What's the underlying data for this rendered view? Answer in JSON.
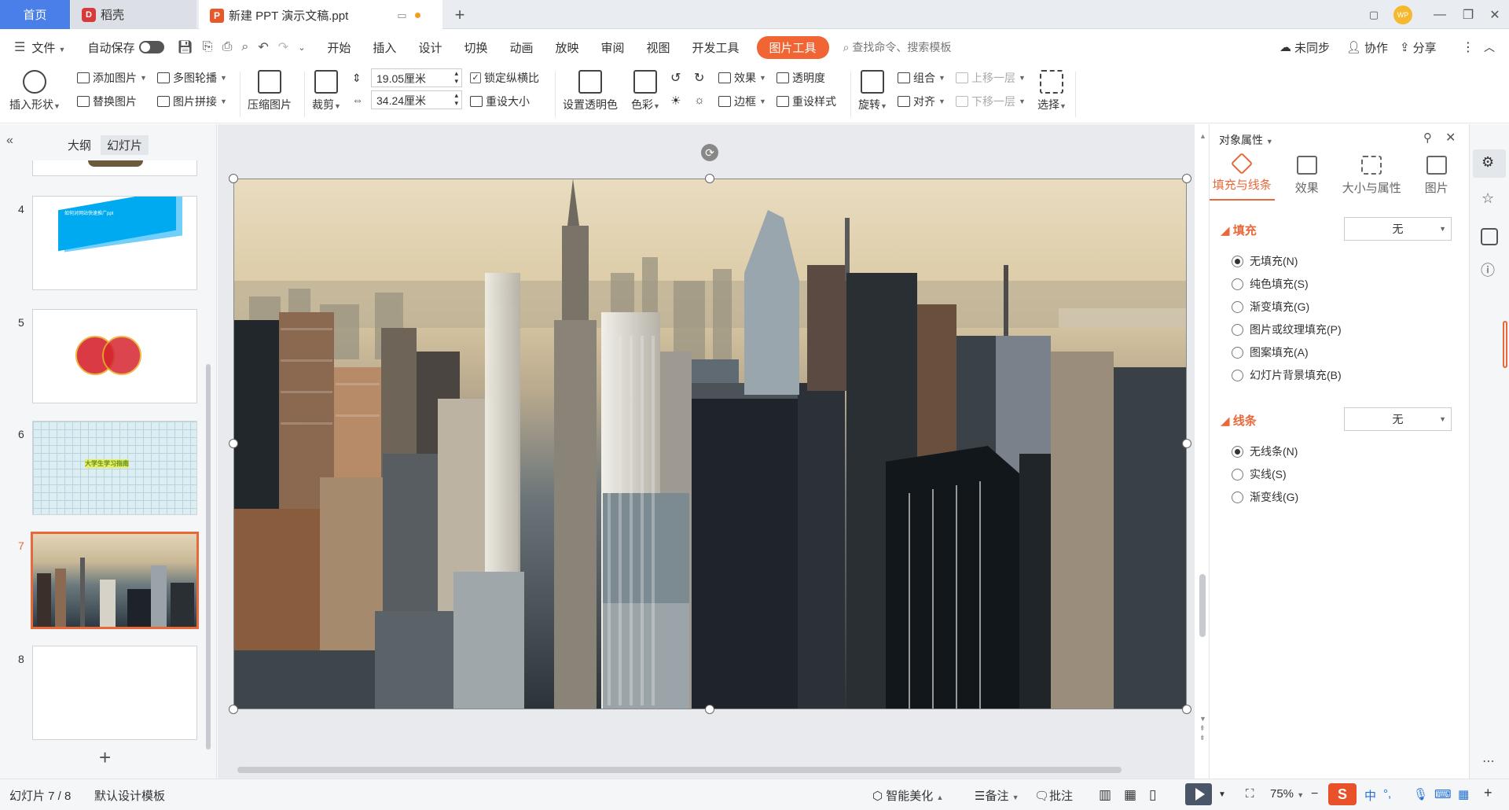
{
  "titlebar": {
    "home_tab": "首页",
    "daoke_tab": "稻壳",
    "doc_tab": "新建 PPT 演示文稿.ppt",
    "add_tab": "+",
    "avatar_text": "WP"
  },
  "menubar": {
    "file": "文件",
    "autosave": "自动保存",
    "items": [
      "开始",
      "插入",
      "设计",
      "切换",
      "动画",
      "放映",
      "审阅",
      "视图",
      "开发工具"
    ],
    "picture_tools": "图片工具",
    "search_placeholder": "查找命令、搜索模板",
    "sync": "未同步",
    "collab": "协作",
    "share": "分享"
  },
  "ribbon": {
    "insert_shape": "插入形状",
    "add_picture": "添加图片",
    "replace_picture": "替换图片",
    "multi_carousel": "多图轮播",
    "picture_collage": "图片拼接",
    "compress": "压缩图片",
    "crop": "裁剪",
    "height_value": "19.05厘米",
    "width_value": "34.24厘米",
    "lock_ratio": "锁定纵横比",
    "reset_size": "重设大小",
    "set_transparent": "设置透明色",
    "color": "色彩",
    "effect": "效果",
    "border": "边框",
    "transparency": "透明度",
    "reset_style": "重设样式",
    "rotate": "旋转",
    "group": "组合",
    "align": "对齐",
    "bring_forward": "上移一层",
    "send_backward": "下移一层",
    "select": "选择"
  },
  "leftpanel": {
    "tab_outline": "大纲",
    "tab_slides": "幻灯片",
    "slides": [
      {
        "num": "4",
        "text": "如何对网站快速推广ppt"
      },
      {
        "num": "5",
        "text": ""
      },
      {
        "num": "6",
        "text": "大学生学习指南"
      },
      {
        "num": "7",
        "text": ""
      },
      {
        "num": "8",
        "text": ""
      }
    ],
    "add_slide": "+"
  },
  "rightpanel": {
    "title": "对象属性",
    "tabs": [
      "填充与线条",
      "效果",
      "大小与属性",
      "图片"
    ],
    "fill_header": "填充",
    "fill_value": "无",
    "fill_options": [
      "无填充(N)",
      "纯色填充(S)",
      "渐变填充(G)",
      "图片或纹理填充(P)",
      "图案填充(A)",
      "幻灯片背景填充(B)"
    ],
    "line_header": "线条",
    "line_value": "无",
    "line_options": [
      "无线条(N)",
      "实线(S)",
      "渐变线(G)"
    ]
  },
  "statusbar": {
    "slide_count": "幻灯片 7 / 8",
    "template": "默认设计模板",
    "smart_beautify": "智能美化",
    "notes": "备注",
    "comments": "批注",
    "zoom": "75%",
    "ime_lang": "中"
  },
  "colors": {
    "accent": "#e8683a",
    "home_tab": "#4a7ee8",
    "picture_tools": "#f06533"
  }
}
